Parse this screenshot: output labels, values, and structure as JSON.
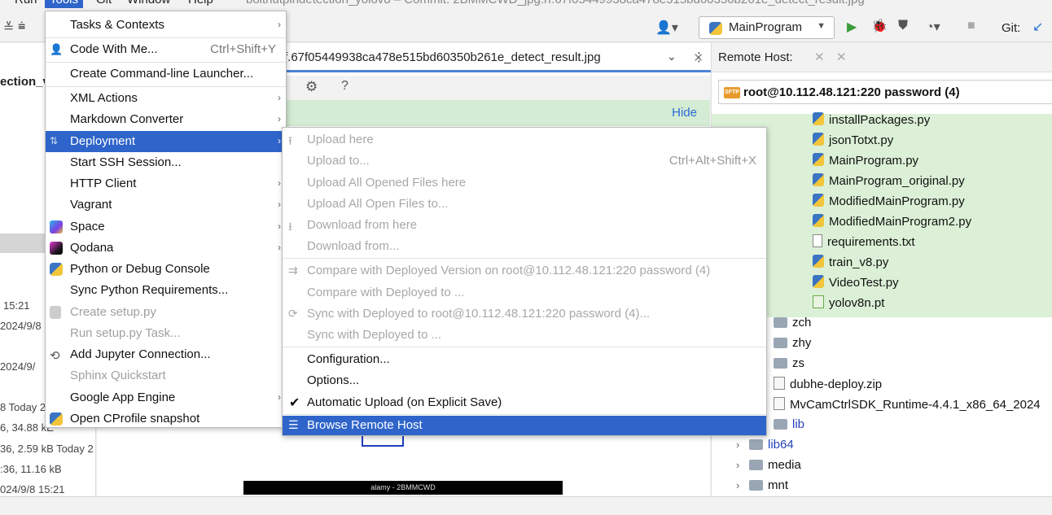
{
  "menubar": {
    "run": "Run",
    "tools": "Tools",
    "git": "Git",
    "window": "Window",
    "help": "Help",
    "window_title": "boltnutpindetection_yolov8 – Commit: 2BMMCWD_jpg.rf.67f05449938ca478e515bd60350b261e_detect_result.jpg"
  },
  "toolbar": {
    "run_config": "MainProgram",
    "git": "Git:"
  },
  "left_pane": {
    "project_name": "ection_v",
    "lines": [
      "15:21",
      "2024/9/8",
      "2024/9/",
      "8 Today 2",
      "6, 34.88 kE",
      "36, 2.59 kB Today 2",
      ":36, 11.16 kB",
      "024/9/8 15:21"
    ]
  },
  "editor": {
    "tab_title": "f.67f05449938ca478e515bd60350b261e_detect_result.jpg",
    "banner_hide": "Hide",
    "image_caption": "alamy - 2BMMCWD"
  },
  "remote": {
    "title": "Remote Host:",
    "host": "root@10.112.48.121:220 password (4)",
    "files": [
      {
        "name": "installPackages.py",
        "type": "py"
      },
      {
        "name": "jsonTotxt.py",
        "type": "py"
      },
      {
        "name": "MainProgram.py",
        "type": "py"
      },
      {
        "name": "MainProgram_original.py",
        "type": "py"
      },
      {
        "name": "ModifiedMainProgram.py",
        "type": "py"
      },
      {
        "name": "ModifiedMainProgram2.py",
        "type": "py"
      },
      {
        "name": "requirements.txt",
        "type": "txt"
      },
      {
        "name": "train_v8.py",
        "type": "py"
      },
      {
        "name": "VideoTest.py",
        "type": "py"
      },
      {
        "name": "yolov8n.pt",
        "type": "pt"
      }
    ],
    "folders": [
      {
        "name": "zch"
      },
      {
        "name": "zhy"
      },
      {
        "name": "zs"
      },
      {
        "name": "dubhe-deploy.zip"
      },
      {
        "name": "MvCamCtrlSDK_Runtime-4.4.1_x86_64_2024"
      },
      {
        "name": "lib"
      },
      {
        "name": "lib64"
      },
      {
        "name": "media"
      },
      {
        "name": "mnt"
      }
    ]
  },
  "tools_menu": {
    "items": [
      {
        "label": "Tasks & Contexts",
        "submenu": true
      },
      {
        "label": "Code With Me...",
        "shortcut": "Ctrl+Shift+Y"
      },
      {
        "label": "Create Command-line Launcher..."
      },
      {
        "label": "XML Actions",
        "submenu": true
      },
      {
        "label": "Markdown Converter",
        "submenu": true
      },
      {
        "label": "Deployment",
        "submenu": true
      },
      {
        "label": "Start SSH Session..."
      },
      {
        "label": "HTTP Client",
        "submenu": true
      },
      {
        "label": "Vagrant",
        "submenu": true
      },
      {
        "label": "Space",
        "submenu": true
      },
      {
        "label": "Qodana",
        "submenu": true
      },
      {
        "label": "Python or Debug Console"
      },
      {
        "label": "Sync Python Requirements..."
      },
      {
        "label": "Create setup.py"
      },
      {
        "label": "Run setup.py Task..."
      },
      {
        "label": "Add Jupyter Connection..."
      },
      {
        "label": "Sphinx Quickstart"
      },
      {
        "label": "Google App Engine",
        "submenu": true
      },
      {
        "label": "Open CProfile snapshot"
      }
    ]
  },
  "deployment_menu": {
    "items": [
      {
        "label": "Upload here"
      },
      {
        "label": "Upload to...",
        "shortcut": "Ctrl+Alt+Shift+X"
      },
      {
        "label": "Upload All Opened Files here"
      },
      {
        "label": "Upload All Open Files to..."
      },
      {
        "label": "Download from here"
      },
      {
        "label": "Download from..."
      },
      {
        "label": "Compare with Deployed Version on root@10.112.48.121:220 password (4)"
      },
      {
        "label": "Compare with Deployed to ..."
      },
      {
        "label": "Sync with Deployed to root@10.112.48.121:220 password (4)..."
      },
      {
        "label": "Sync with Deployed to ..."
      },
      {
        "label": "Configuration..."
      },
      {
        "label": "Options..."
      },
      {
        "label": "Automatic Upload (on Explicit Save)"
      },
      {
        "label": "Browse Remote Host"
      }
    ]
  },
  "colors": {
    "selection": "#2f65ca",
    "banner": "#d3ecd3",
    "remote_highlight": "#dbf0d6"
  }
}
